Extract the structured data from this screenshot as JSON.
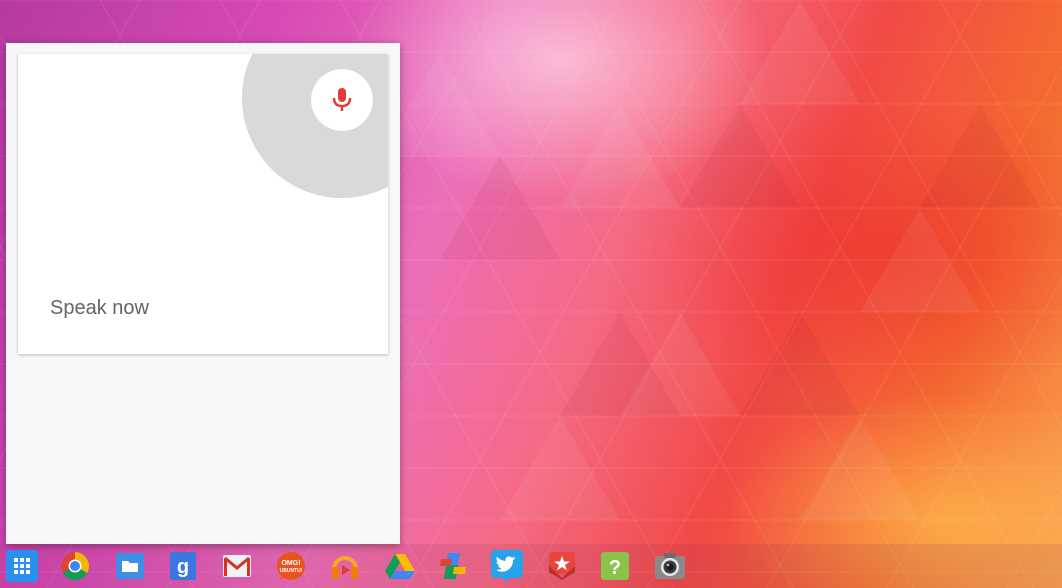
{
  "voice_search": {
    "prompt": "Speak now"
  },
  "shelf": {
    "apps": [
      {
        "name": "app-launcher",
        "icon": "grid-icon"
      },
      {
        "name": "chrome",
        "icon": "chrome-icon"
      },
      {
        "name": "files",
        "icon": "folder-icon"
      },
      {
        "name": "google-search",
        "icon": "google-g-icon"
      },
      {
        "name": "gmail",
        "icon": "gmail-icon"
      },
      {
        "name": "omg-ubuntu",
        "icon": "omg-ubuntu-icon"
      },
      {
        "name": "play-music",
        "icon": "headphones-icon"
      },
      {
        "name": "google-drive",
        "icon": "drive-icon"
      },
      {
        "name": "google-news",
        "icon": "news-icon"
      },
      {
        "name": "twitter",
        "icon": "twitter-bird-icon"
      },
      {
        "name": "pocket",
        "icon": "bookmark-star-icon"
      },
      {
        "name": "help",
        "icon": "question-icon"
      },
      {
        "name": "camera",
        "icon": "camera-icon"
      }
    ],
    "omg_logo_text": "OMG! UBUNTU!"
  },
  "colors": {
    "mic_red": "#e53935",
    "launcher_blue": "#2a8ff0",
    "twitter_blue": "#27a3ec"
  }
}
